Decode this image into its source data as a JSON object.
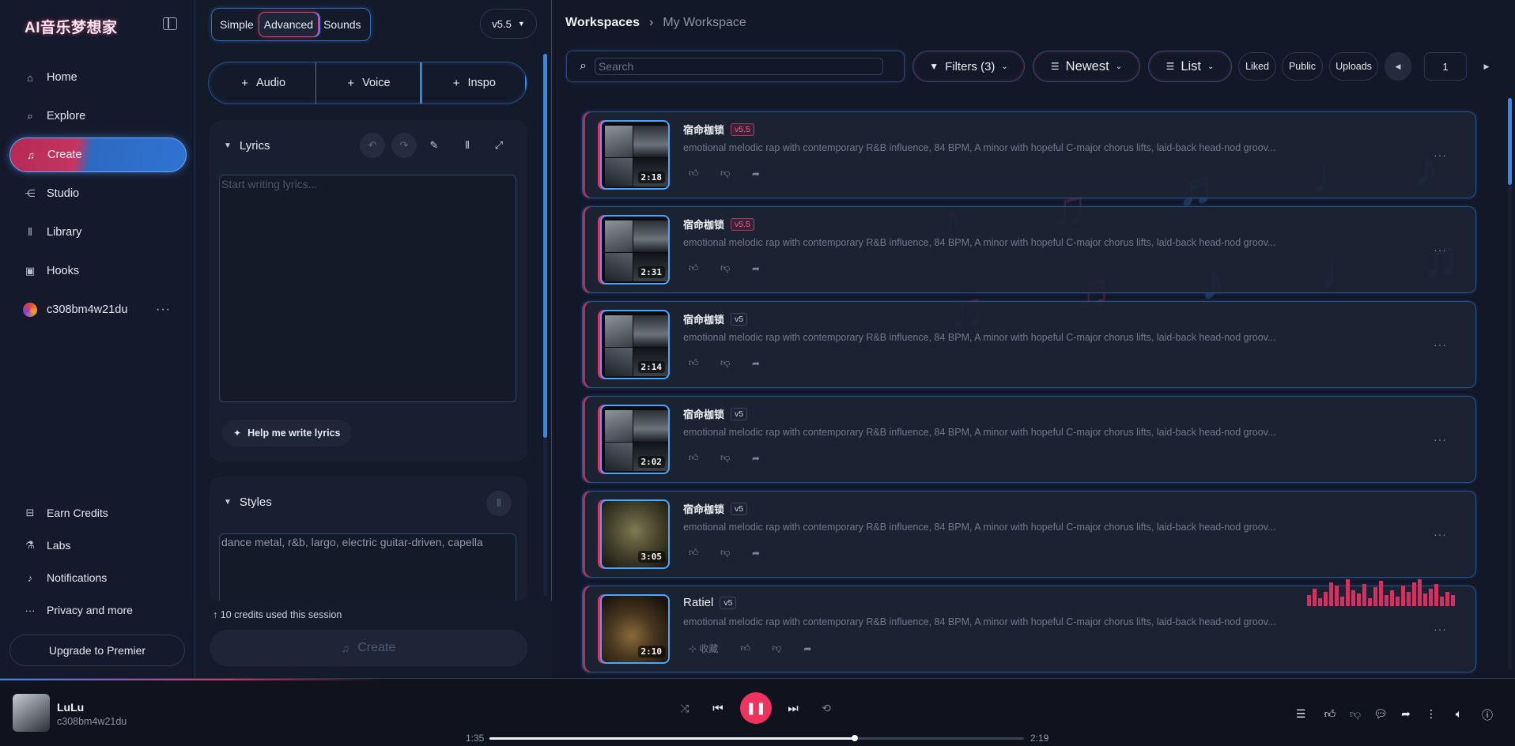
{
  "sidebar": {
    "brand": "AI音乐梦想家",
    "nav": [
      {
        "label": "Home",
        "icon": "home-icon"
      },
      {
        "label": "Explore",
        "icon": "search-icon"
      },
      {
        "label": "Create",
        "icon": "music-note-icon",
        "active": true
      },
      {
        "label": "Studio",
        "icon": "studio-icon"
      },
      {
        "label": "Library",
        "icon": "library-icon"
      },
      {
        "label": "Hooks",
        "icon": "hooks-icon"
      }
    ],
    "user": "c308bm4w21du",
    "bottom": [
      {
        "label": "Earn Credits",
        "icon": "gift-icon"
      },
      {
        "label": "Labs",
        "icon": "flask-icon"
      },
      {
        "label": "Notifications",
        "icon": "bell-icon"
      },
      {
        "label": "Privacy and more",
        "icon": "ellipsis-icon"
      }
    ],
    "upgrade": "Upgrade to Premier"
  },
  "panel": {
    "tabs": [
      "Simple",
      "Advanced",
      "Sounds"
    ],
    "active_tab": "Advanced",
    "version": "v5.5",
    "add_buttons": [
      "Audio",
      "Voice",
      "Inspo"
    ],
    "lyrics": {
      "title": "Lyrics",
      "placeholder": "Start writing lyrics...",
      "help": "Help me write lyrics"
    },
    "styles": {
      "title": "Styles",
      "value": "dance metal, r&b, largo, electric guitar-driven, capella"
    },
    "credits": "10 credits used this session",
    "create": "Create"
  },
  "main": {
    "breadcrumb": {
      "root": "Workspaces",
      "current": "My Workspace"
    },
    "search_placeholder": "Search",
    "filters": "Filters (3)",
    "sort": "Newest",
    "view": "List",
    "chips": [
      "Liked",
      "Public",
      "Uploads"
    ],
    "page": "1",
    "songs": [
      {
        "title": "宿命枷锁",
        "version": "v5.5",
        "hot": true,
        "duration": "2:18",
        "thumb": "gray"
      },
      {
        "title": "宿命枷锁",
        "version": "v5.5",
        "hot": true,
        "duration": "2:31",
        "thumb": "gray"
      },
      {
        "title": "宿命枷锁",
        "version": "v5",
        "hot": false,
        "duration": "2:14",
        "thumb": "gray"
      },
      {
        "title": "宿命枷锁",
        "version": "v5",
        "hot": false,
        "duration": "2:02",
        "thumb": "gray"
      },
      {
        "title": "宿命枷锁",
        "version": "v5",
        "hot": false,
        "duration": "3:05",
        "thumb": "olive"
      },
      {
        "title": "Ratiel",
        "version": "v5",
        "hot": false,
        "duration": "2:10",
        "thumb": "warm",
        "collect": "收藏"
      }
    ],
    "description": "emotional melodic rap with contemporary R&B influence, 84 BPM, A minor with hopeful C-major chorus lifts, laid-back head-nod groov..."
  },
  "player": {
    "song": "LuLu",
    "artist": "c308bm4w21du",
    "elapsed": "1:35",
    "total": "2:19",
    "progress": 0.683
  },
  "colors": {
    "accent_pink": "#f0325e",
    "accent_blue": "#3b86ea"
  }
}
